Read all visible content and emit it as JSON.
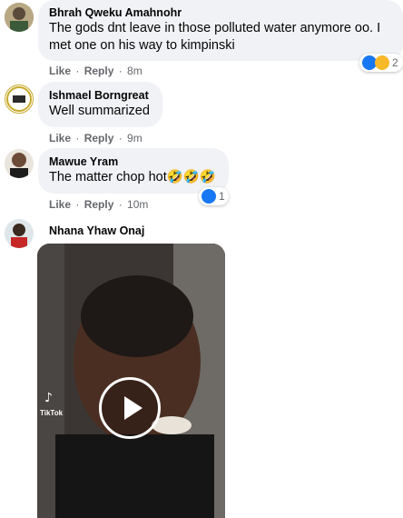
{
  "comments": [
    {
      "author": "Bhrah Qweku Amahnohr",
      "text_line1": "The gods dnt leave in those polluted water anymore oo. I",
      "text_line2": "met one on his way to kimpinski",
      "like_label": "Like",
      "reply_label": "Reply",
      "time": "8m",
      "reaction_count": "2"
    },
    {
      "author": "Ishmael Borngreat",
      "text": "Well summarized",
      "like_label": "Like",
      "reply_label": "Reply",
      "time": "9m"
    },
    {
      "author": "Mawue Yram",
      "text": "The matter chop hot🤣🤣🤣",
      "like_label": "Like",
      "reply_label": "Reply",
      "time": "10m",
      "reaction_count": "1"
    },
    {
      "author": "Nhana Yhaw Onaj",
      "video": {
        "watermark": "TikTok"
      }
    }
  ],
  "colors": {
    "bubble": "#f0f2f5",
    "meta_text": "#65676b",
    "like_blue": "#1877f2"
  }
}
